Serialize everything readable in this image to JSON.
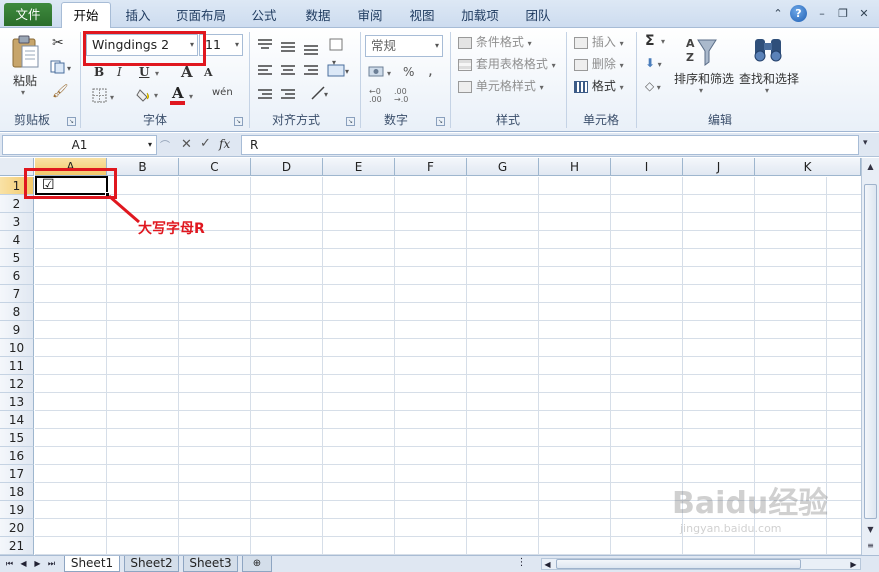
{
  "tabs": {
    "file": "文件",
    "home": "开始",
    "insert": "插入",
    "page_layout": "页面布局",
    "formulas": "公式",
    "data": "数据",
    "review": "审阅",
    "view": "视图",
    "addins": "加载项",
    "team": "团队"
  },
  "ribbon": {
    "clipboard": {
      "paste": "粘贴",
      "group": "剪贴板"
    },
    "font": {
      "font_name": "Wingdings 2",
      "font_size": "11",
      "group": "字体",
      "bold": "B",
      "italic": "I",
      "underline": "U",
      "grow": "A",
      "shrink": "A",
      "color": "A",
      "phonetic": "wén"
    },
    "alignment": {
      "group": "对齐方式"
    },
    "number": {
      "format": "常规",
      "percent": "%",
      "comma": ",",
      "group": "数字"
    },
    "styles": {
      "conditional": "条件格式",
      "table": "套用表格格式",
      "cell_styles": "单元格样式",
      "group": "样式"
    },
    "cells": {
      "insert": "插入",
      "delete": "删除",
      "format": "格式",
      "group": "单元格"
    },
    "editing": {
      "sum": "Σ",
      "sort_filter": "排序和筛选",
      "find_select": "查找和选择",
      "group": "编辑"
    }
  },
  "formula_bar": {
    "name_box": "A1",
    "fx": "fx",
    "content": "R"
  },
  "grid": {
    "columns": [
      "A",
      "B",
      "C",
      "D",
      "E",
      "F",
      "G",
      "H",
      "I",
      "J",
      "K"
    ],
    "rows": [
      "1",
      "2",
      "3",
      "4",
      "5",
      "6",
      "7",
      "8",
      "9",
      "10",
      "11",
      "12",
      "13",
      "14",
      "15",
      "16",
      "17",
      "18",
      "19",
      "20",
      "21"
    ],
    "a1_display": "☑"
  },
  "sheets": [
    "Sheet1",
    "Sheet2",
    "Sheet3"
  ],
  "annotation": {
    "text": "大写字母R"
  },
  "watermark": {
    "logo": "Baidu经验",
    "sub": "jingyan.baidu.com"
  },
  "colors": {
    "highlight_red": "#e0171f",
    "file_tab_green": "#2b6e2b",
    "selected_header": "#f3c96a"
  }
}
